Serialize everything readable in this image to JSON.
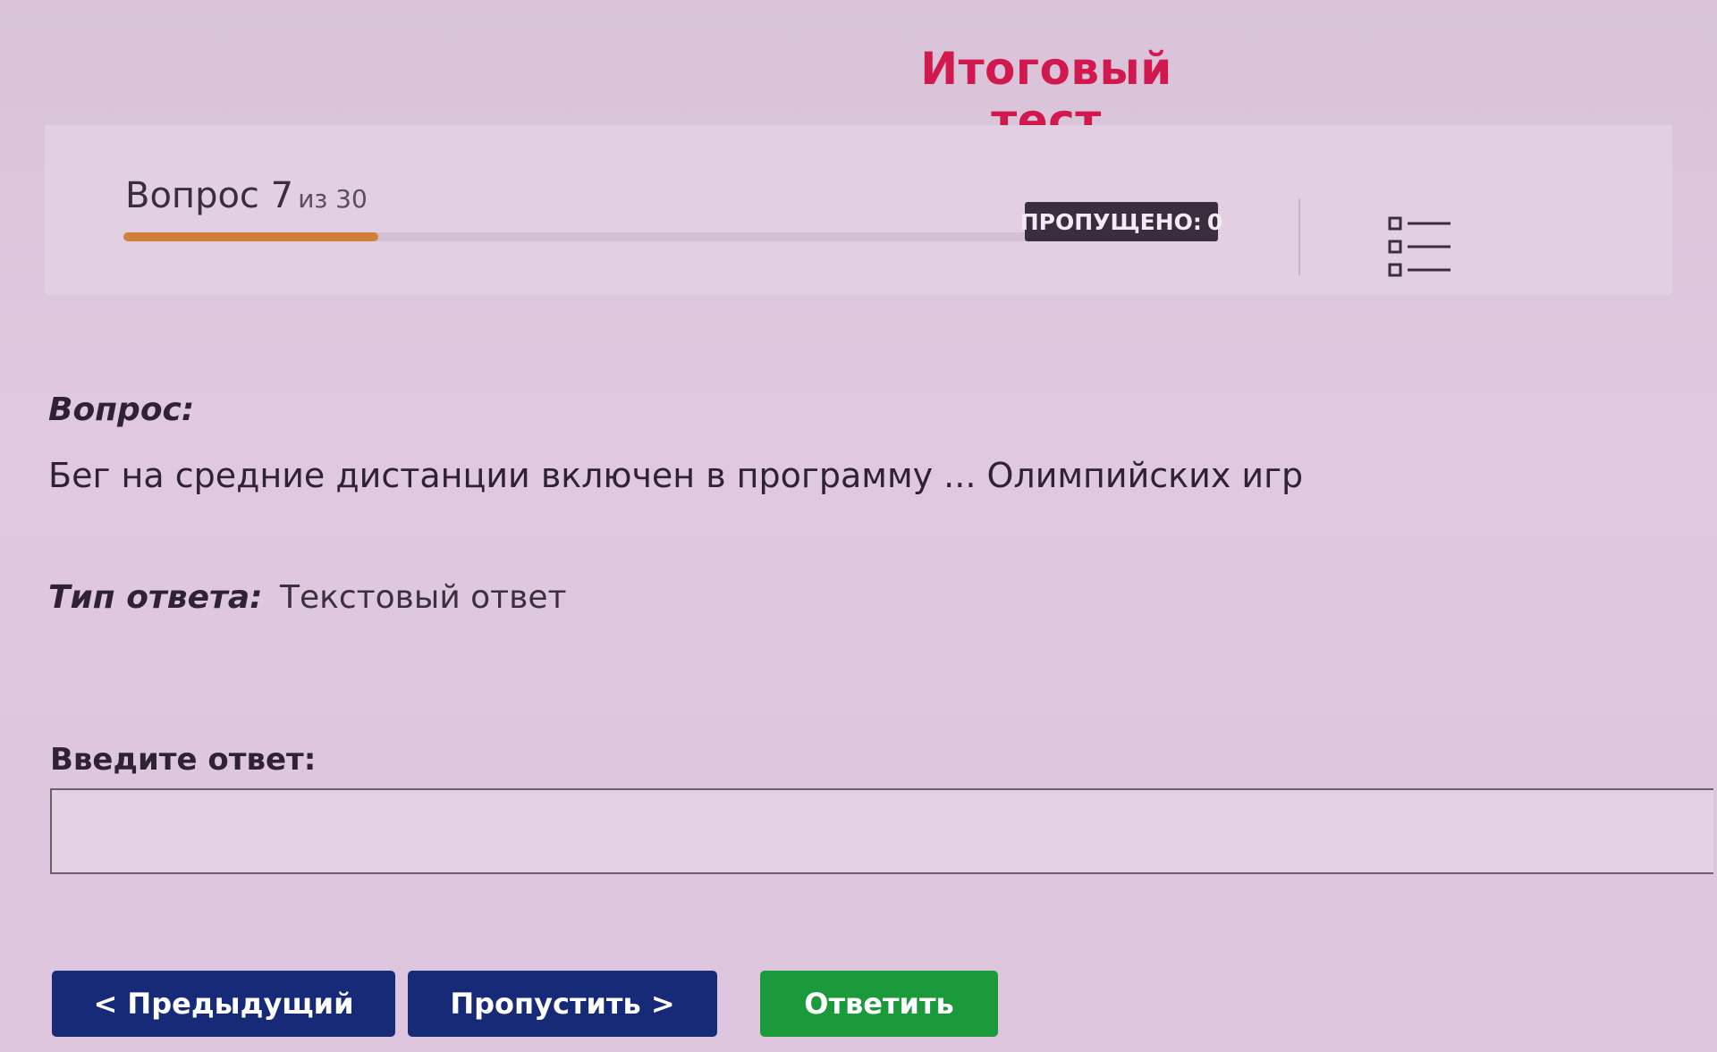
{
  "page": {
    "title": "Итоговый тест"
  },
  "header": {
    "question_label": "Вопрос 7",
    "question_total": "из 30",
    "current_question": 7,
    "total_questions": 30,
    "skipped_label": "ПРОПУЩЕНО:",
    "skipped_count": "0",
    "list_icon": "list-icon"
  },
  "question": {
    "heading": "Вопрос:",
    "text": "Бег на средние дистанции включен в программу ... Олимпийских игр",
    "answer_type_label": "Тип ответа:",
    "answer_type_value": "Текстовый ответ"
  },
  "answer": {
    "label": "Введите ответ:",
    "value": "",
    "placeholder": ""
  },
  "buttons": {
    "prev": "< Предыдущий",
    "skip": "Пропустить >",
    "submit": "Ответить"
  },
  "colors": {
    "title": "#d2194f",
    "progress": "#d0803a",
    "badge": "#3a2e3e",
    "nav_button": "#172a78",
    "submit_button": "#1a9a3a"
  }
}
